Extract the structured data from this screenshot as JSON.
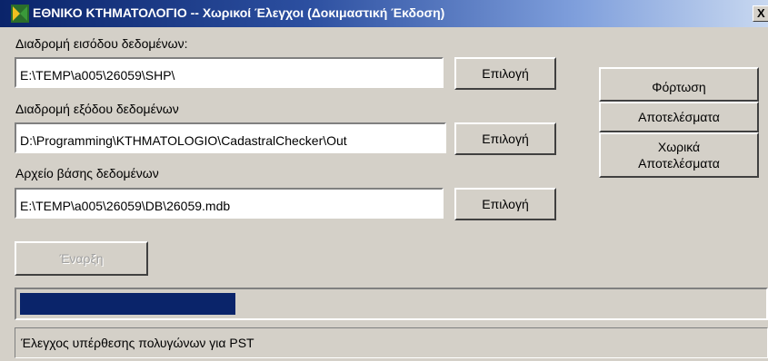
{
  "window": {
    "title": "ΕΘΝΙΚΟ ΚΤΗΜΑΤΟΛΟΓΙΟ -- Χωρικοί Έλεγχοι (Δοκιμαστική Έκδοση)",
    "close_label": "X",
    "icon": "app-logo-icon"
  },
  "input_path": {
    "label": "Διαδρομή εισόδου δεδομένων:",
    "value": "E:\\TEMP\\a005\\26059\\SHP\\",
    "button_label": "Επιλογή"
  },
  "output_path": {
    "label": "Διαδρομή εξόδου δεδομένων",
    "value": "D:\\Programming\\KTHMATOLOGIO\\CadastralChecker\\Out",
    "button_label": "Επιλογή"
  },
  "database_file": {
    "label": "Αρχείο βάσης δεδομένων",
    "value": "E:\\TEMP\\a005\\26059\\DB\\26059.mdb",
    "button_label": "Επιλογή"
  },
  "actions": {
    "load_label": "Φόρτωση",
    "results_label": "Αποτελέσματα",
    "spatial_results_label": "Χωρικά\nΑποτελέσματα",
    "start_label": "Έναρξη"
  },
  "progress": {
    "fraction": 0.29,
    "color": "#0a246a"
  },
  "status": {
    "text": "Έλεγχος υπέρθεσης πολυγώνων για PST"
  }
}
